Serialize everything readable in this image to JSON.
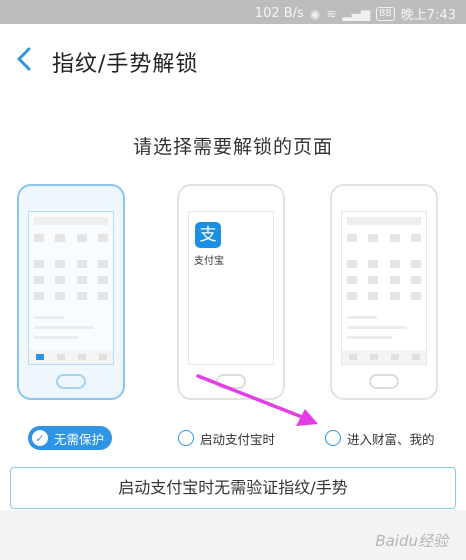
{
  "status_bar": {
    "net_speed": "102 B/s",
    "battery": "88",
    "time": "晚上7:43"
  },
  "header": {
    "back_icon": "chevron-left-icon",
    "title": "指纹/手势解锁"
  },
  "main": {
    "subtitle": "请选择需要解锁的页面",
    "options": [
      {
        "label": "无需保护",
        "selected": true
      },
      {
        "label": "启动支付宝时",
        "selected": false
      },
      {
        "label": "进入财富、我的",
        "selected": false
      }
    ],
    "alipay_logo_char": "支",
    "alipay_label": "支付宝",
    "hint": "启动支付宝时无需验证指纹/手势"
  },
  "watermark": "Baidu经验",
  "colors": {
    "accent": "#2e94e6",
    "status_bar": "#bdbdbd",
    "arrow": "#e63ce6"
  }
}
